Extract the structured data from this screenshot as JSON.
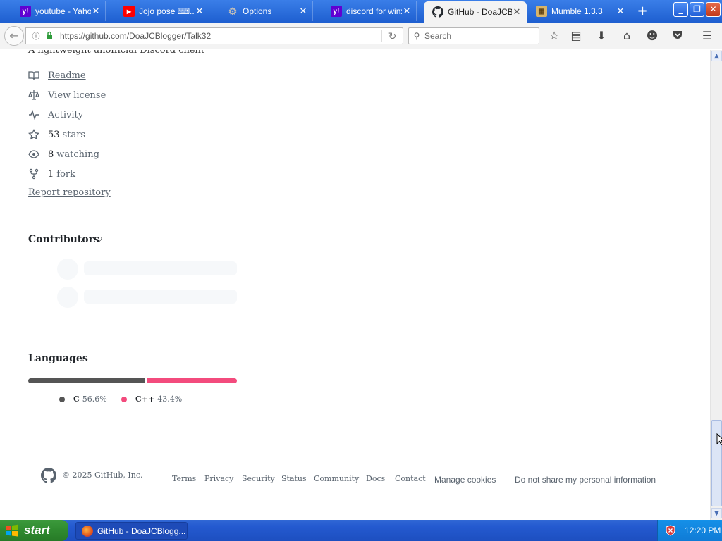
{
  "browser": {
    "tabs": [
      {
        "label": "youtube - Yaho...",
        "icon": "yahoo-icon",
        "active": false
      },
      {
        "label": "Jojo pose ⌨...",
        "icon": "youtube-icon",
        "active": false
      },
      {
        "label": "Options",
        "icon": "gear-icon",
        "active": false
      },
      {
        "label": "discord for winx...",
        "icon": "yahoo-icon",
        "active": false
      },
      {
        "label": "GitHub - DoaJCB...",
        "icon": "github-icon",
        "active": true
      },
      {
        "label": "Mumble 1.3.3",
        "icon": "mumble-icon",
        "active": false
      }
    ],
    "url": "https://github.com/DoaJCBlogger/Talk32",
    "search_placeholder": "Search"
  },
  "repo": {
    "description": "A lightweight unofficial Discord client",
    "meta": [
      {
        "icon": "book-icon",
        "label": "Readme",
        "link": true
      },
      {
        "icon": "law-icon",
        "label": "View license",
        "link": true
      },
      {
        "icon": "pulse-icon",
        "label": "Activity",
        "link": false
      },
      {
        "icon": "star-icon",
        "count": "53",
        "label": "stars",
        "link": false
      },
      {
        "icon": "eye-icon",
        "count": "8",
        "label": "watching",
        "link": false
      },
      {
        "icon": "fork-icon",
        "count": "1",
        "label": "fork",
        "link": false
      }
    ],
    "report": "Report repository",
    "contributors_title": "Contributors",
    "contributors_count": "2",
    "languages_title": "Languages",
    "languages": [
      {
        "name": "C",
        "percent_label": "56.6%",
        "share": 56.6,
        "color": "#555555"
      },
      {
        "name": "C++",
        "percent_label": "43.4%",
        "share": 43.4,
        "color": "#f34b7d"
      }
    ]
  },
  "footer": {
    "copyright": "© 2025 GitHub, Inc.",
    "links": [
      "Terms",
      "Privacy",
      "Security",
      "Status",
      "Community",
      "Docs",
      "Contact"
    ],
    "manage_cookies": "Manage cookies",
    "do_not_share": "Do not share my personal information"
  },
  "taskbar": {
    "start_label": "start",
    "task_label": "GitHub - DoaJCBlogg...",
    "clock": "12:20 PM"
  }
}
